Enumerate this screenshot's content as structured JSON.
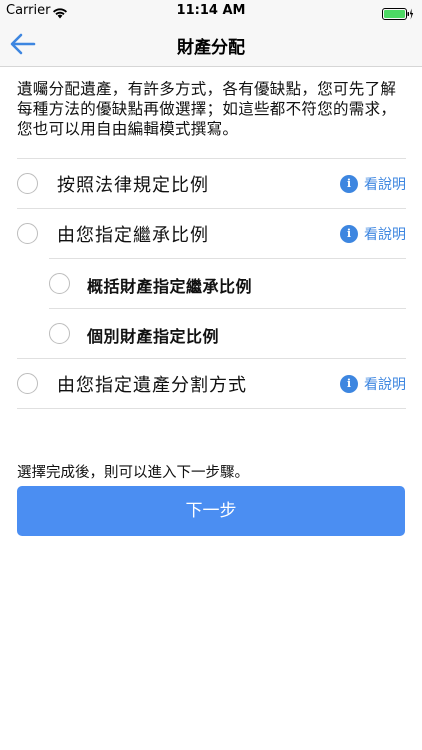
{
  "status_bar": {
    "carrier": "Carrier",
    "time": "11:14 AM"
  },
  "nav": {
    "title": "財產分配",
    "back_icon": "back-arrow-icon"
  },
  "intro": "遺囑分配遺產，有許多方式，各有優缺點，您可先了解每種方法的優缺點再做選擇；如這些都不符您的需求，您也可以用自由編輯模式撰寫。",
  "options": [
    {
      "label": "按照法律規定比例",
      "info": "看說明",
      "info_icon": "i"
    },
    {
      "label": "由您指定繼承比例",
      "info": "看說明",
      "info_icon": "i"
    },
    {
      "label": "概括財產指定繼承比例"
    },
    {
      "label": "個別財產指定比例"
    },
    {
      "label": "由您指定遺產分割方式",
      "info": "看說明",
      "info_icon": "i"
    }
  ],
  "after_text": "選擇完成後，則可以進入下一步驟。",
  "next_button": "下一步",
  "colors": {
    "accent": "#3d86e0",
    "button": "#4b8ef2"
  }
}
